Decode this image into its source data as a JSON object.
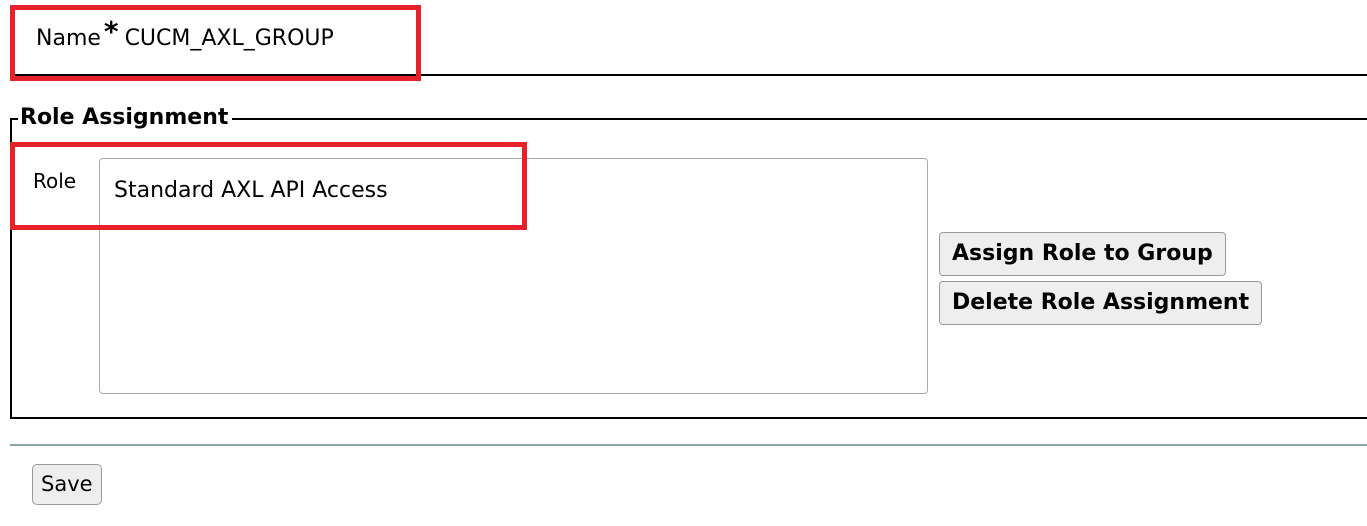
{
  "group": {
    "name_label": "Name",
    "required_marker": "*",
    "name_value": "CUCM_AXL_GROUP"
  },
  "role_assignment": {
    "legend": "Role Assignment",
    "role_label": "Role",
    "roles": [
      "Standard AXL API Access"
    ],
    "assign_button": "Assign Role to Group",
    "delete_button": "Delete Role Assignment"
  },
  "footer": {
    "save_button": "Save"
  },
  "colors": {
    "highlight": "#e8202a",
    "button_bg": "#eeeeee",
    "divider": "#8aa5a8"
  }
}
